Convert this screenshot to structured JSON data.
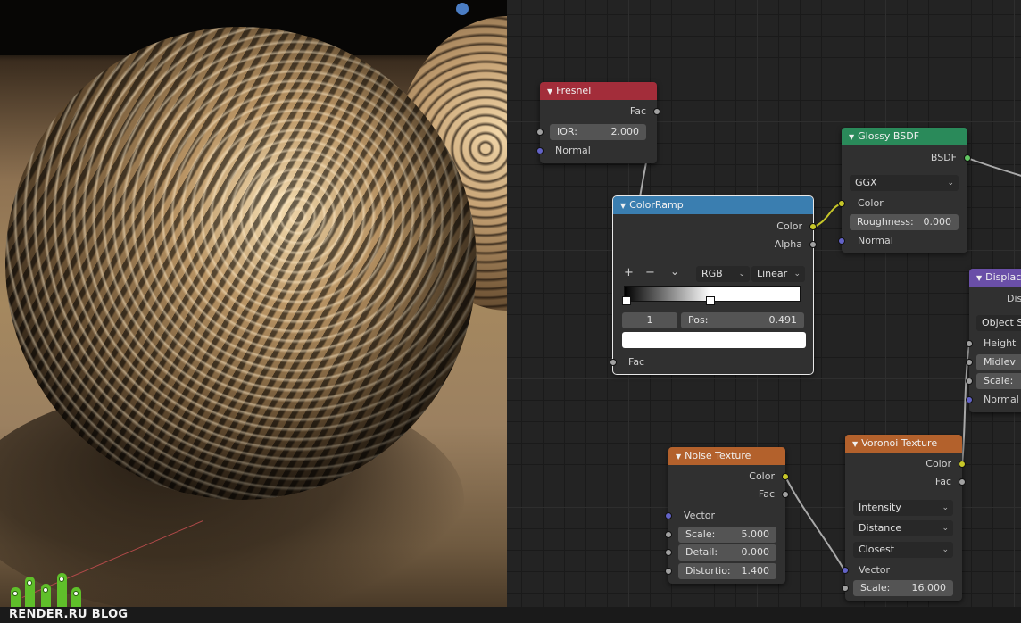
{
  "brand": {
    "name": "RENDER.RU",
    "suffix": "BLOG"
  },
  "nodes": {
    "fresnel": {
      "title": "Fresnel",
      "out_fac": "Fac",
      "ior_label": "IOR:",
      "ior_value": "2.000",
      "normal_label": "Normal"
    },
    "colorramp": {
      "title": "ColorRamp",
      "out_color": "Color",
      "out_alpha": "Alpha",
      "tool_add": "+",
      "tool_remove": "−",
      "tool_menu": "⌄",
      "color_mode": "RGB",
      "interpolation": "Linear",
      "stop_index": "1",
      "pos_label": "Pos:",
      "pos_value": "0.491",
      "stop_position": 0.491,
      "in_fac": "Fac"
    },
    "glossy": {
      "title": "Glossy BSDF",
      "out_bsdf": "BSDF",
      "distribution": "GGX",
      "color_label": "Color",
      "roughness_label": "Roughness:",
      "roughness_value": "0.000",
      "normal_label": "Normal"
    },
    "displacement": {
      "title": "Displac",
      "out_disp": "Dis",
      "space": "Object S",
      "height_label": "Height",
      "midlevel_label": "Midlev",
      "scale_label": "Scale:",
      "normal_label": "Normal"
    },
    "noise": {
      "title": "Noise Texture",
      "out_color": "Color",
      "out_fac": "Fac",
      "vector_label": "Vector",
      "scale_label": "Scale:",
      "scale_value": "5.000",
      "detail_label": "Detail:",
      "detail_value": "0.000",
      "distortion_label": "Distortio:",
      "distortion_value": "1.400"
    },
    "voronoi": {
      "title": "Voronoi Texture",
      "out_color": "Color",
      "out_fac": "Fac",
      "coloring": "Intensity",
      "distance": "Distance",
      "feature": "Closest",
      "vector_label": "Vector",
      "scale_label": "Scale:",
      "scale_value": "16.000"
    }
  },
  "colors": {
    "socket_float": "#a1a1a1",
    "socket_color": "#c7c729",
    "socket_vector": "#6363c7",
    "socket_shader": "#63c763",
    "link": "#b8b8b8"
  },
  "icons": {
    "collapse": "triangle-down-icon",
    "dropdown": "chevron-down-icon"
  }
}
